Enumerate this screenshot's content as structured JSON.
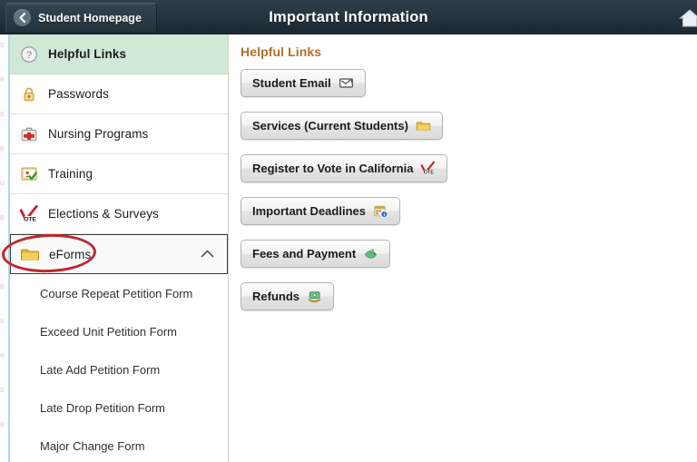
{
  "header": {
    "title": "Important Information",
    "back_label": "Student Homepage",
    "back_icon": "chevron-left-icon",
    "home_icon": "home-icon",
    "bg_color": "#253540"
  },
  "sidebar": {
    "items": [
      {
        "label": "Helpful Links",
        "icon": "question-mark-circle-icon",
        "active": true,
        "selected": false
      },
      {
        "label": "Passwords",
        "icon": "padlock-icon",
        "active": false,
        "selected": false
      },
      {
        "label": "Nursing Programs",
        "icon": "medical-kit-icon",
        "active": false,
        "selected": false
      },
      {
        "label": "Training",
        "icon": "training-certificate-icon",
        "active": false,
        "selected": false
      },
      {
        "label": "Elections & Surveys",
        "icon": "vote-checkmark-icon",
        "active": false,
        "selected": false
      },
      {
        "label": "eForms",
        "icon": "folder-icon",
        "active": false,
        "selected": true,
        "expanded": true,
        "expand_icon": "chevron-up-icon"
      }
    ],
    "sub_items": [
      {
        "label": "Course Repeat Petition Form"
      },
      {
        "label": "Exceed Unit Petition Form"
      },
      {
        "label": "Late Add Petition Form"
      },
      {
        "label": "Late Drop Petition Form"
      },
      {
        "label": "Major Change Form"
      }
    ],
    "active_bg_color": "#cfe9d6",
    "annotation": {
      "shape": "ellipse",
      "color": "#c0272d",
      "targets": "eForms"
    }
  },
  "main": {
    "heading": "Helpful Links",
    "heading_color": "#b3702a",
    "buttons": [
      {
        "label": "Student Email",
        "icon": "email-envelope-icon"
      },
      {
        "label": "Services (Current Students)",
        "icon": "folder-icon"
      },
      {
        "label": "Register to Vote in California",
        "icon": "vote-checkmark-icon"
      },
      {
        "label": "Important Deadlines",
        "icon": "calendar-info-icon"
      },
      {
        "label": "Fees and Payment",
        "icon": "money-bird-icon"
      },
      {
        "label": "Refunds",
        "icon": "cash-hand-icon"
      }
    ]
  },
  "ghost_edge": {
    "lines": [
      "s",
      "e",
      "s",
      "e",
      "u",
      "e",
      "s",
      "e",
      "s",
      "e",
      "s",
      "e"
    ]
  }
}
